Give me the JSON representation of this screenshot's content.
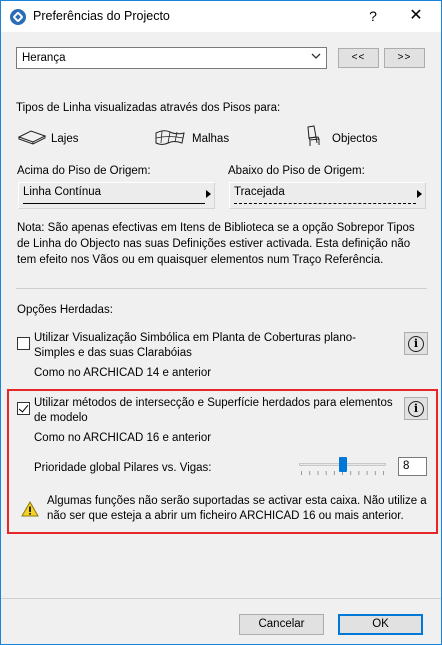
{
  "window": {
    "title": "Preferências do Projecto",
    "help_label": "?",
    "close_label": "✕"
  },
  "profile": {
    "selected": "Herança",
    "prev_label": "<<",
    "next_label": ">>"
  },
  "line_types": {
    "heading": "Tipos de Linha visualizadas através dos Pisos para:",
    "options": [
      {
        "label": "Lajes",
        "icon": "slab-icon"
      },
      {
        "label": "Malhas",
        "icon": "mesh-icon"
      },
      {
        "label": "Objectos",
        "icon": "chair-object-icon"
      }
    ],
    "above_label": "Acima do Piso de Origem:",
    "above_value": "Linha Contínua",
    "below_label": "Abaixo do Piso de Origem:",
    "below_value": "Tracejada",
    "note": "Nota: São apenas efectivas em Itens de Biblioteca se a opção Sobrepor Tipos de Linha do Objecto nas suas Definições estiver activada. Esta definição não tem efeito nos Vãos ou em quaisquer elementos num Traço Referência."
  },
  "inherited": {
    "heading": "Opções Herdadas:",
    "option1": {
      "label": "Utilizar Visualização Simbólica em Planta de Coberturas plano-Simples e das suas Clarabóias",
      "checked": false,
      "sublabel": "Como no ARCHICAD 14 e anterior"
    },
    "option2": {
      "label": "Utilizar métodos de intersecção e Superfície herdados para elementos de modelo",
      "checked": true,
      "sublabel": "Como no ARCHICAD 16 e anterior",
      "priority_label": "Prioridade global Pilares vs. Vigas:",
      "priority_value": "8",
      "warning": "Algumas funções não serão suportadas se activar esta caixa. Não utilize a não ser que esteja a abrir um ficheiro ARCHICAD 16 ou mais anterior."
    }
  },
  "footer": {
    "cancel_label": "Cancelar",
    "ok_label": "OK"
  },
  "colors": {
    "accent": "#0078d7",
    "highlight_border": "#e8262a",
    "warning": "#f6d224"
  }
}
